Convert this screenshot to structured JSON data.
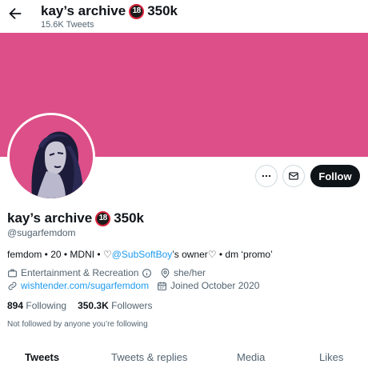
{
  "header": {
    "title": "kay’s archive",
    "title_suffix": "350k",
    "tweet_count": "15.6K Tweets"
  },
  "badge": {
    "label": "18"
  },
  "profile": {
    "name": "kay’s archive",
    "name_suffix": "350k",
    "handle": "@sugarfemdom",
    "bio_prefix": "femdom • 20 • MDNI • ♡",
    "bio_mention": "@SubSoftBoy",
    "bio_suffix": "’s owner♡ • dm ‘promo’",
    "category": "Entertainment & Recreation",
    "pronouns": "she/her",
    "website": "wishtender.com/sugarfemdom",
    "joined": "Joined October 2020"
  },
  "stats": {
    "following_count": "894",
    "following_label": "Following",
    "followers_count": "350.3K",
    "followers_label": "Followers"
  },
  "not_followed_text": "Not followed by anyone you’re following",
  "actions": {
    "follow_label": "Follow"
  },
  "tabs": [
    {
      "label": "Tweets",
      "active": true
    },
    {
      "label": "Tweets & replies",
      "active": false
    },
    {
      "label": "Media",
      "active": false
    },
    {
      "label": "Likes",
      "active": false
    }
  ],
  "colors": {
    "banner": "#dd4f88",
    "link": "#1d9bf0",
    "follow_button": "#0f1419",
    "muted_text": "#536471"
  }
}
